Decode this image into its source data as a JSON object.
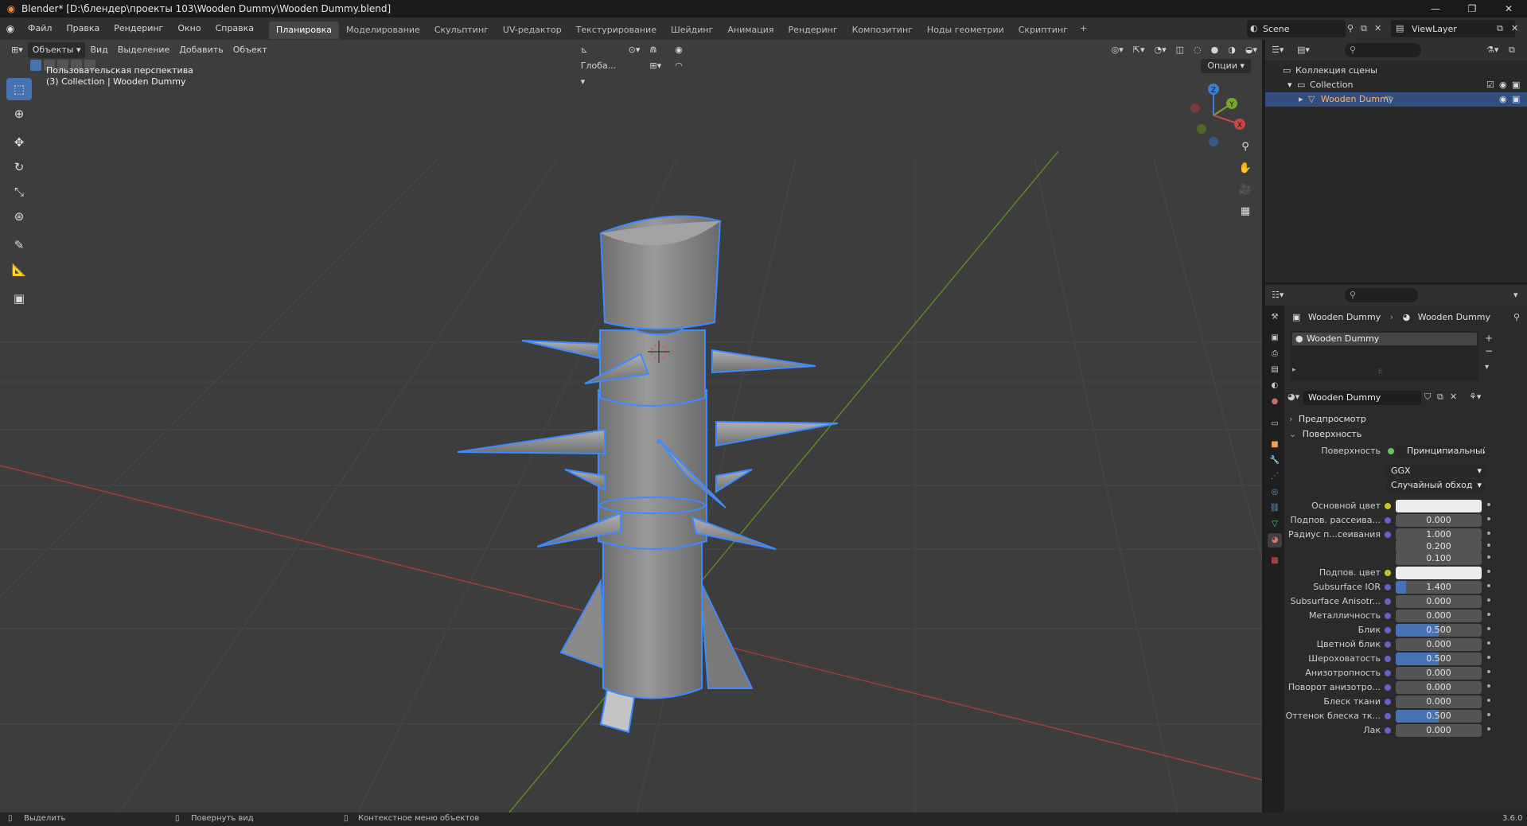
{
  "window": {
    "title": "Blender* [D:\\блендер\\проекты 103\\Wooden Dummy\\Wooden Dummy.blend]",
    "minimize": "—",
    "maximize": "❐",
    "close": "✕"
  },
  "menu": [
    "Файл",
    "Правка",
    "Рендеринг",
    "Окно",
    "Справка"
  ],
  "workspaces": [
    "Планировка",
    "Моделирование",
    "Скульптинг",
    "UV-редактор",
    "Текстурирование",
    "Шейдинг",
    "Анимация",
    "Рендеринг",
    "Композитинг",
    "Ноды геометрии",
    "Скриптинг"
  ],
  "active_workspace": "Планировка",
  "scene": {
    "name": "Scene",
    "view_layer": "ViewLayer"
  },
  "viewport": {
    "mode": "Объекты",
    "menus": [
      "Вид",
      "Выделение",
      "Добавить",
      "Объект"
    ],
    "transform_orientation": "Глоба...",
    "options": "Опции",
    "overlay_line1": "Пользовательская перспектива",
    "overlay_line2": "(3) Collection | Wooden Dummy",
    "gizmo": {
      "x": "X",
      "y": "Y",
      "z": "Z"
    }
  },
  "outliner": {
    "root": "Коллекция сцены",
    "collection": "Collection",
    "object": "Wooden Dummy"
  },
  "properties": {
    "breadcrumb_object": "Wooden Dummy",
    "breadcrumb_material": "Wooden Dummy",
    "material_slot": "Wooden Dummy",
    "material_name": "Wooden Dummy",
    "panel_preview": "Предпросмотр",
    "panel_surface": "Поверхность",
    "surface_label": "Поверхность",
    "surface_shader": "Принципиальный BSDF",
    "distribution": "GGX",
    "subsurface_method": "Случайный обход",
    "rows": [
      {
        "label": "Основной цвет",
        "value": "",
        "kind": "color"
      },
      {
        "label": "Подпов. рассеива...",
        "value": "0.000",
        "kind": "num",
        "fill": 0
      },
      {
        "label": "Радиус п...сеивания",
        "value": "1.000",
        "kind": "num",
        "fill": 0
      },
      {
        "label": "",
        "value": "0.200",
        "kind": "num",
        "fill": 0
      },
      {
        "label": "",
        "value": "0.100",
        "kind": "num",
        "fill": 0
      },
      {
        "label": "Подпов. цвет",
        "value": "",
        "kind": "color"
      },
      {
        "label": "Subsurface IOR",
        "value": "1.400",
        "kind": "num",
        "fill": 0.12
      },
      {
        "label": "Subsurface Anisotr...",
        "value": "0.000",
        "kind": "num",
        "fill": 0
      },
      {
        "label": "Металличность",
        "value": "0.000",
        "kind": "num",
        "fill": 0
      },
      {
        "label": "Блик",
        "value": "0.500",
        "kind": "num",
        "fill": 0.5
      },
      {
        "label": "Цветной блик",
        "value": "0.000",
        "kind": "num",
        "fill": 0
      },
      {
        "label": "Шероховатость",
        "value": "0.500",
        "kind": "num",
        "fill": 0.5
      },
      {
        "label": "Анизотропность",
        "value": "0.000",
        "kind": "num",
        "fill": 0
      },
      {
        "label": "Поворот анизотро...",
        "value": "0.000",
        "kind": "num",
        "fill": 0
      },
      {
        "label": "Блеск ткани",
        "value": "0.000",
        "kind": "num",
        "fill": 0
      },
      {
        "label": "Оттенок блеска тк...",
        "value": "0.500",
        "kind": "num",
        "fill": 0.5
      },
      {
        "label": "Лак",
        "value": "0.000",
        "kind": "num",
        "fill": 0
      }
    ]
  },
  "status": {
    "select": "Выделить",
    "rotate_view": "Повернуть вид",
    "context_menu": "Контекстное меню объектов",
    "version": "3.6.0"
  },
  "colors": {
    "accent": "#4772b3",
    "selection_outline": "#3d8bff",
    "x_axis": "#c94848",
    "y_axis": "#78a628",
    "z_axis": "#3f7fd1"
  }
}
